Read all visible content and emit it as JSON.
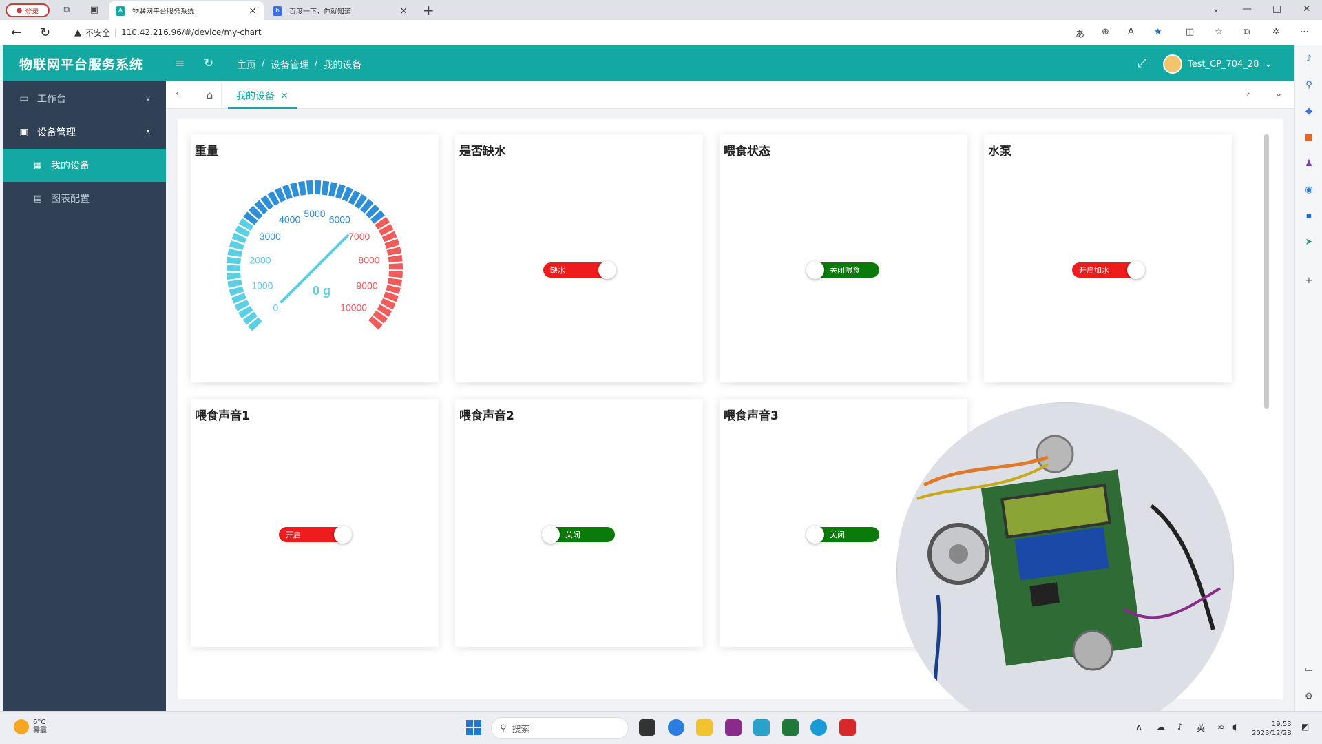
{
  "browser": {
    "login_label": "登录",
    "tabs": [
      {
        "title": "物联网平台服务系统",
        "active": true
      },
      {
        "title": "百度一下，你就知道",
        "active": false
      }
    ],
    "security_label": "不安全",
    "url": "110.42.216.96/#/device/my-chart"
  },
  "app": {
    "title": "物联网平台服务系统",
    "breadcrumb": [
      "主页",
      "设备管理",
      "我的设备"
    ],
    "user": "Test_CP_704_28"
  },
  "sidebar": {
    "items": [
      {
        "label": "工作台",
        "expanded": false
      },
      {
        "label": "设备管理",
        "expanded": true,
        "children": [
          {
            "label": "我的设备",
            "active": true
          },
          {
            "label": "图表配置",
            "active": false
          }
        ]
      }
    ]
  },
  "tagsview": {
    "active_tag": "我的设备"
  },
  "gauge": {
    "title": "重量",
    "value": 0,
    "unit": "g",
    "readout": "0 g",
    "min": 0,
    "max": 10000,
    "ticks": [
      "0",
      "1000",
      "2000",
      "3000",
      "4000",
      "5000",
      "6000",
      "7000",
      "8000",
      "9000",
      "10000"
    ],
    "colors": {
      "low": "#5bcfe3",
      "mid": "#2e8ed8",
      "high": "#f05b5b"
    }
  },
  "cards": [
    {
      "title": "是否缺水",
      "state": "on",
      "label": "缺水"
    },
    {
      "title": "喂食状态",
      "state": "off",
      "label": "关闭喂食"
    },
    {
      "title": "水泵",
      "state": "on",
      "label": "开启加水"
    },
    {
      "title": "喂食声音1",
      "state": "on",
      "label": "开启"
    },
    {
      "title": "喂食声音2",
      "state": "off",
      "label": "关闭"
    },
    {
      "title": "喂食声音3",
      "state": "off",
      "label": "关闭"
    }
  ],
  "colors": {
    "accent": "#13a8a1",
    "sidebar": "#304156",
    "switch_on": "#ee1c1c",
    "switch_off": "#0a7a0a"
  },
  "taskbar": {
    "weather_temp": "6°C",
    "weather_desc": "雾霾",
    "search_placeholder": "搜索",
    "ime": "英",
    "time": "19:53",
    "date": "2023/12/28"
  }
}
